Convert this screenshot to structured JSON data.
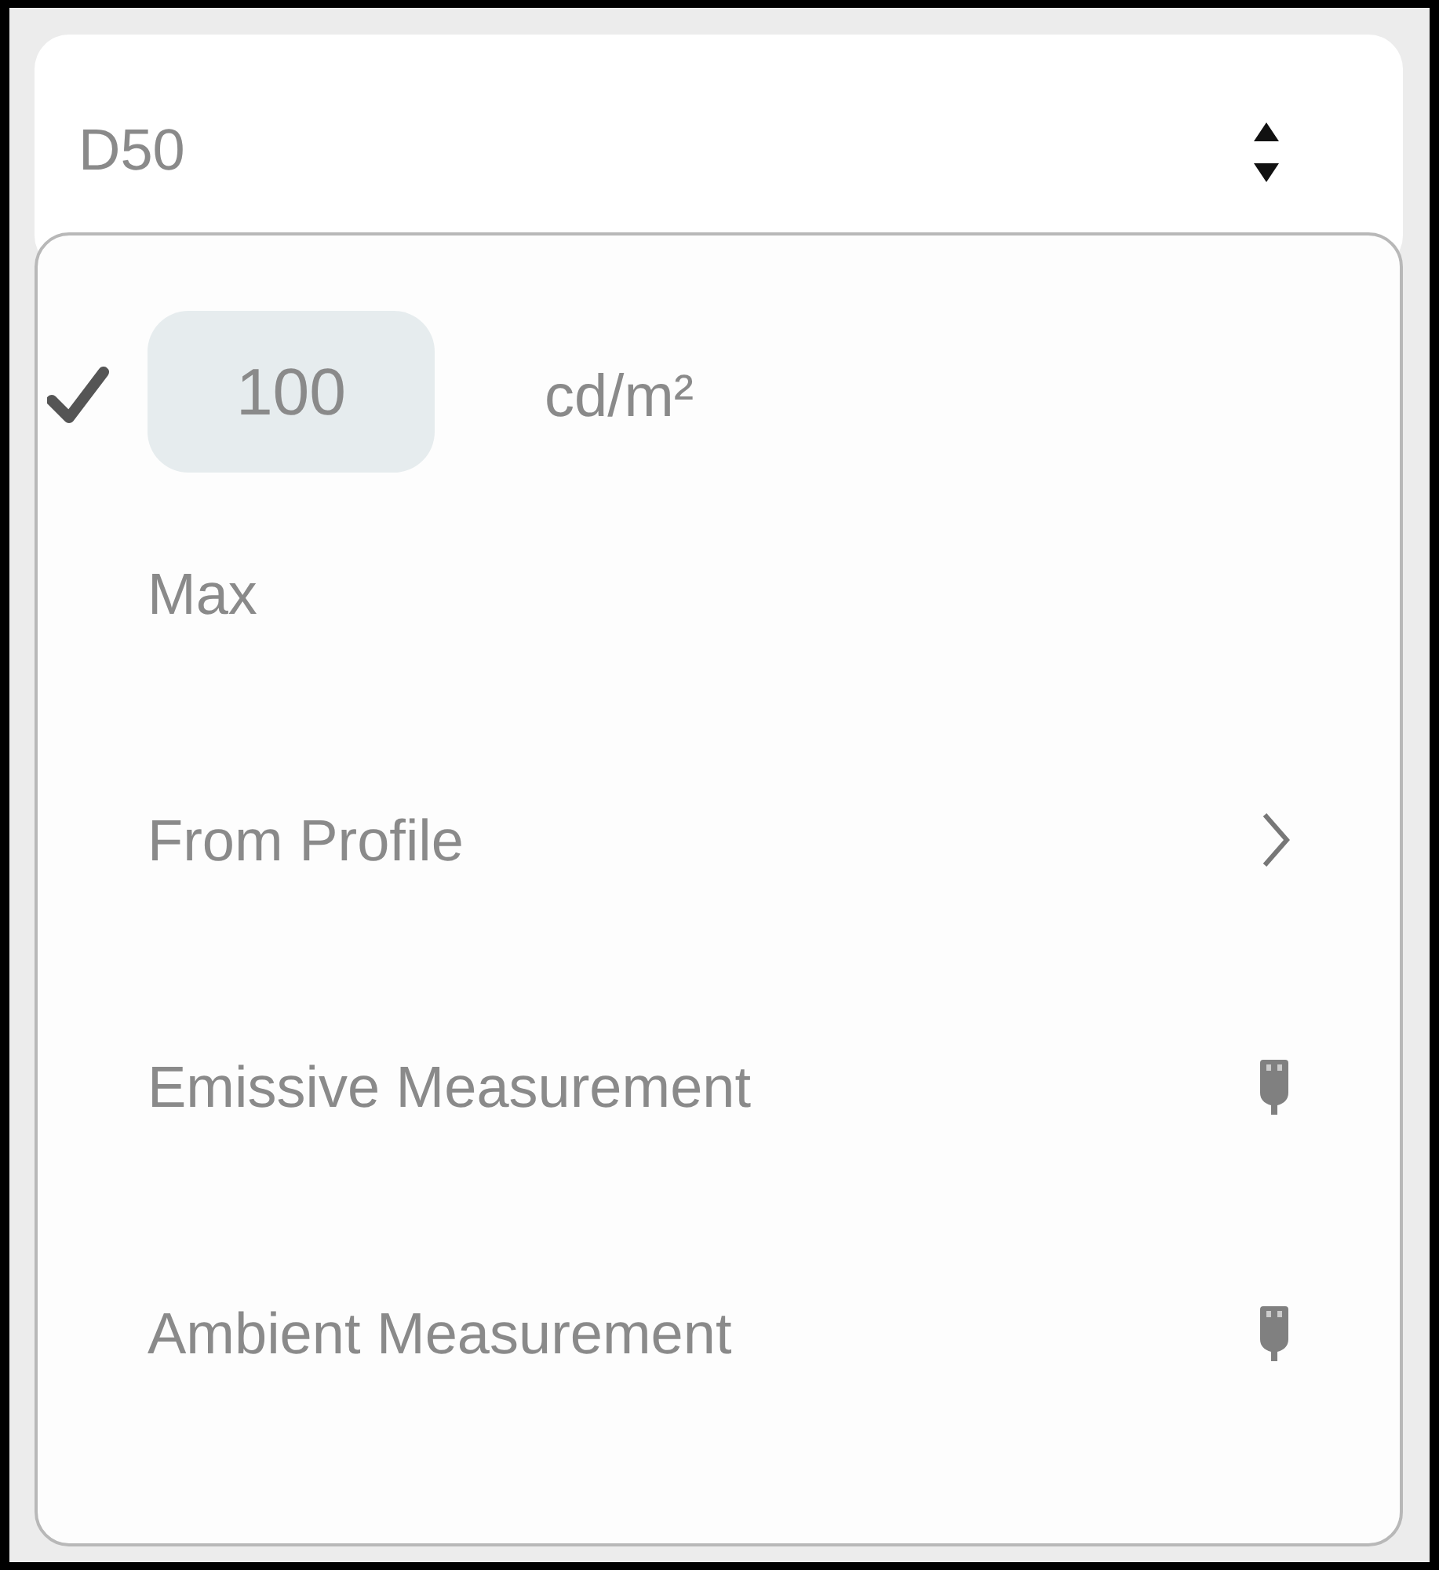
{
  "select": {
    "value": "D50"
  },
  "menu": {
    "items": [
      {
        "kind": "value",
        "selected": true,
        "value": "100",
        "unit": "cd/m²"
      },
      {
        "kind": "option",
        "selected": false,
        "label": "Max"
      },
      {
        "kind": "submenu",
        "selected": false,
        "label": "From Profile"
      },
      {
        "kind": "device",
        "selected": false,
        "label": "Emissive Measurement"
      },
      {
        "kind": "device",
        "selected": false,
        "label": "Ambient Measurement"
      }
    ]
  }
}
